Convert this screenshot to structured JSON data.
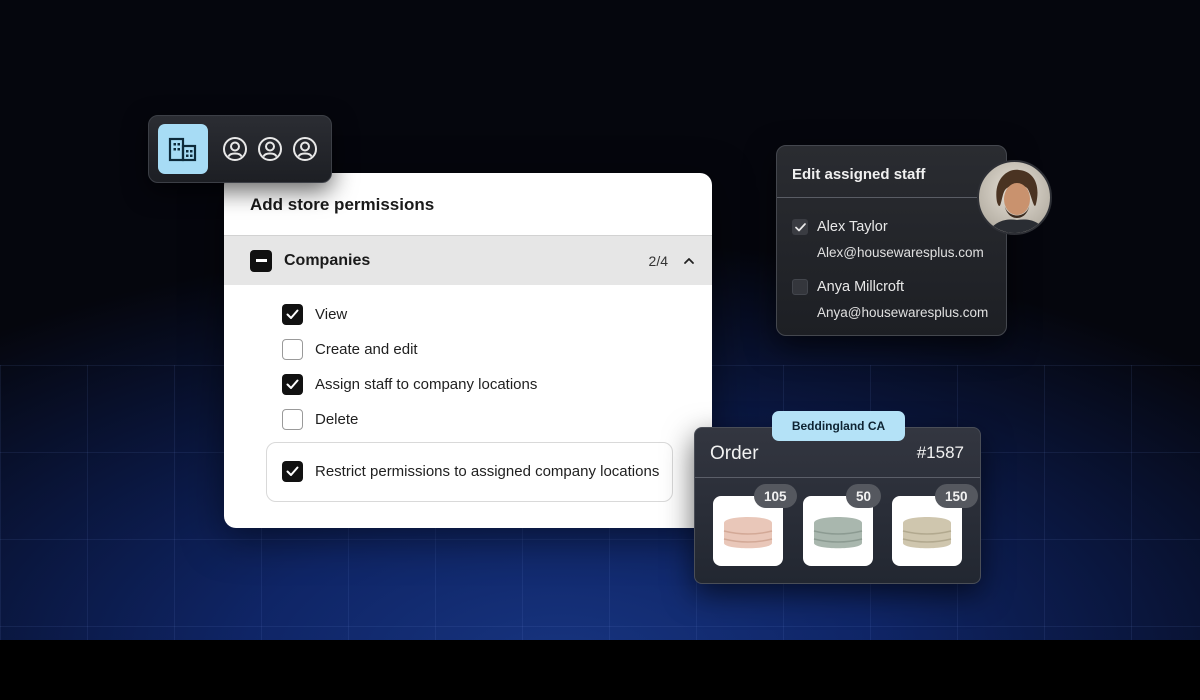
{
  "toolbar": {
    "icons": [
      "building-icon",
      "user-circle-icon",
      "user-circle-icon",
      "user-circle-icon"
    ]
  },
  "permissions": {
    "title": "Add store permissions",
    "section": {
      "label": "Companies",
      "count": "2/4",
      "expanded": true
    },
    "items": [
      {
        "label": "View",
        "checked": true
      },
      {
        "label": "Create and edit",
        "checked": false
      },
      {
        "label": "Assign staff to company locations",
        "checked": true
      },
      {
        "label": "Delete",
        "checked": false
      }
    ],
    "restrict": {
      "label": "Restrict permissions to assigned company locations",
      "checked": true
    }
  },
  "staff": {
    "title": "Edit assigned staff",
    "members": [
      {
        "name": "Alex Taylor",
        "email": "Alex@housewaresplus.com",
        "checked": true
      },
      {
        "name": "Anya Millcroft",
        "email": "Anya@housewaresplus.com",
        "checked": false
      }
    ]
  },
  "order": {
    "location": "Beddingland CA",
    "label": "Order",
    "number": "#1587",
    "products": [
      {
        "quantity": "105",
        "color": "#e9c7b9"
      },
      {
        "quantity": "50",
        "color": "#a9b7ae"
      },
      {
        "quantity": "150",
        "color": "#cfc6ae"
      }
    ]
  },
  "colors": {
    "accent": "#a7dcf5",
    "badge": "#b4e2f7",
    "checkbox": "#111111"
  }
}
